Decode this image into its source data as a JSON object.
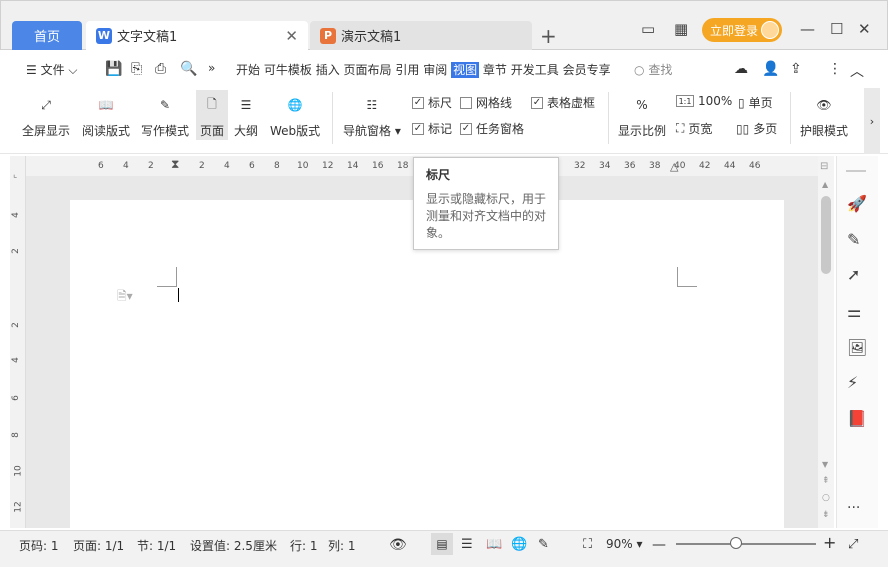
{
  "tabs": {
    "home": "首页",
    "doc": "文字文稿1",
    "ppt": "演示文稿1"
  },
  "title_right": {
    "login": "立即登录"
  },
  "menu": {
    "file": "文件",
    "items": [
      "开始",
      "可牛模板",
      "插入",
      "页面布局",
      "引用",
      "审阅",
      "视图",
      "章节",
      "开发工具",
      "会员专享"
    ],
    "active": "视图",
    "search": "查找"
  },
  "ribbon": {
    "fullscreen": "全屏显示",
    "reading": "阅读版式",
    "writing": "写作模式",
    "page": "页面",
    "outline": "大纲",
    "web": "Web版式",
    "nav": "导航窗格",
    "ruler": "标尺",
    "gridlines": "网格线",
    "table_virtual": "表格虚框",
    "mark": "标记",
    "taskpane": "任务窗格",
    "zoom_ratio": "显示比例",
    "hundred": "100%",
    "single": "单页",
    "page_width": "页宽",
    "multi": "多页",
    "eye": "护眼模式",
    "hundred_icon": "1:1"
  },
  "ruler_h": [
    "6",
    "4",
    "2",
    "2",
    "4",
    "6",
    "8",
    "10",
    "12",
    "14",
    "16",
    "18",
    "32",
    "34",
    "36",
    "38",
    "40",
    "42",
    "44",
    "46"
  ],
  "ruler_v": [
    "4",
    "2",
    "2",
    "4",
    "6",
    "8",
    "10",
    "12"
  ],
  "tooltip": {
    "title": "标尺",
    "body": "显示或隐藏标尺，用于测量和对齐文档中的对象。"
  },
  "status": {
    "page": "页码: 1",
    "pages": "页面: 1/1",
    "section": "节: 1/1",
    "setting": "设置值: 2.5厘米",
    "row": "行: 1",
    "col": "列: 1",
    "zoom": "90%"
  },
  "colors": {
    "accent": "#3b78e7",
    "login": "#f5a623"
  }
}
